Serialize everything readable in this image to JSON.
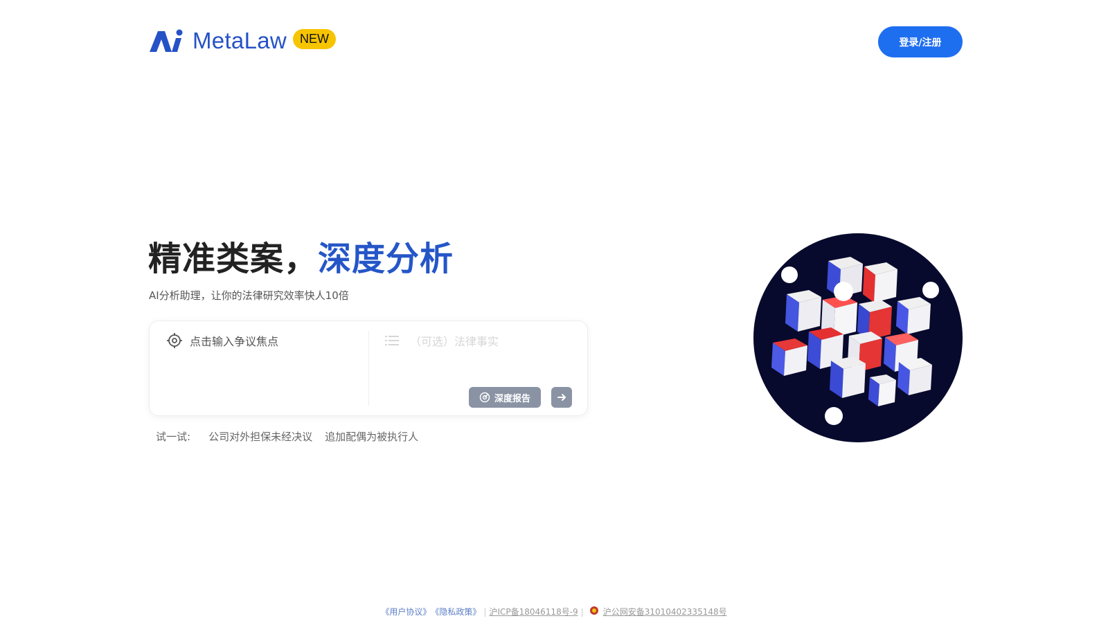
{
  "header": {
    "brand": "MetaLaw",
    "badge": "NEW",
    "login_label": "登录/注册",
    "brand_color": "#2652c7",
    "badge_color": "#f7c400"
  },
  "hero": {
    "title_part1": "精准类案，",
    "title_part2": "深度分析",
    "subtitle": "AI分析助理，让你的法律研究效率快人10倍"
  },
  "input_card": {
    "issue_placeholder": "点击输入争议焦点",
    "facts_placeholder": "（可选）法律事实",
    "report_label": "深度报告",
    "issue_icon": "target-icon",
    "facts_icon": "list-icon",
    "report_icon": "report-icon",
    "submit_icon": "arrow-right-icon"
  },
  "try": {
    "label": "试一试:",
    "examples": [
      "公司对外担保未经决议",
      "追加配偶为被执行人"
    ]
  },
  "footer": {
    "user_agreement": "《用户协议》",
    "privacy_policy": "《隐私政策》",
    "icp": "沪ICP备18046118号-9",
    "police": "沪公网安备31010402335148号"
  },
  "colors": {
    "accent": "#2556c8",
    "primary_button": "#1e6ef0",
    "disabled_button": "#8a93a4"
  }
}
